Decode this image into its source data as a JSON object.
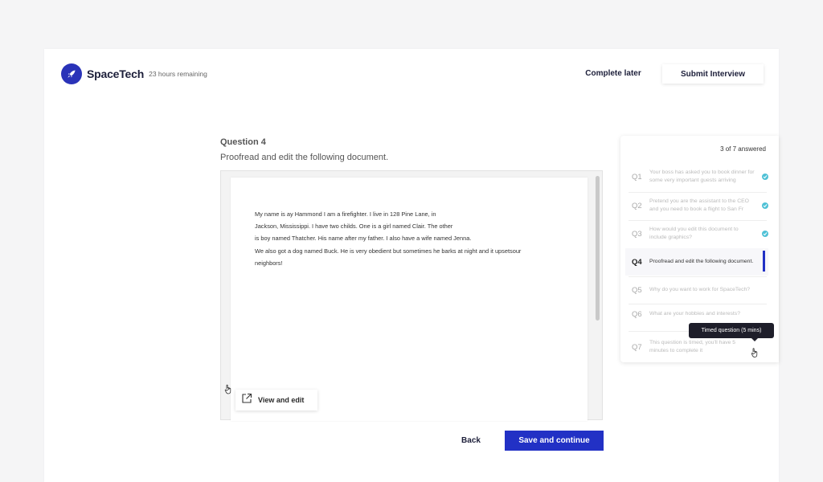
{
  "header": {
    "brand_name": "SpaceTech",
    "time_remaining": "23 hours remaining",
    "complete_later_label": "Complete later",
    "submit_label": "Submit Interview"
  },
  "question": {
    "title": "Question 4",
    "instruction": "Proofread and edit the following document."
  },
  "document": {
    "lines": [
      "My name is ay Hammond I am a firefighter. I live in 128 Pine Lane, in",
      "Jackson, Mississippi. I have two childs. One is a girl named Clair.  The other",
      "is boy named Thatcher.  His name after my father. I also have a wife named Jenna.",
      "We also got a dog named Buck. He is very obedient but sometimes he barks at night and it upsetsour",
      "neighbors!"
    ],
    "view_edit_label": "View and edit"
  },
  "footer": {
    "back_label": "Back",
    "save_label": "Save and continue"
  },
  "panel": {
    "answered_text": "3 of 7 answered",
    "items": [
      {
        "num": "Q1",
        "text": "Your boss has asked you to book dinner for some very important guests arriving"
      },
      {
        "num": "Q2",
        "text": "Pretend you are the assistant to the CEO and you need to book a flight to San Fr"
      },
      {
        "num": "Q3",
        "text": "How would you edit this document to include graphics?"
      },
      {
        "num": "Q4",
        "text": "Proofread and edit the following document."
      },
      {
        "num": "Q5",
        "text": "Why do you want to work for SpaceTech?"
      },
      {
        "num": "Q6",
        "text": "What are your hobbies and interests?"
      },
      {
        "num": "Q7",
        "text": "This question is timed, you'll have 5 minutes to complete it"
      }
    ],
    "tooltip": "Timed question (5 mins)"
  },
  "colors": {
    "brand": "#2a33b8",
    "primary_button": "#2231c5",
    "check": "#4fc1d6"
  }
}
